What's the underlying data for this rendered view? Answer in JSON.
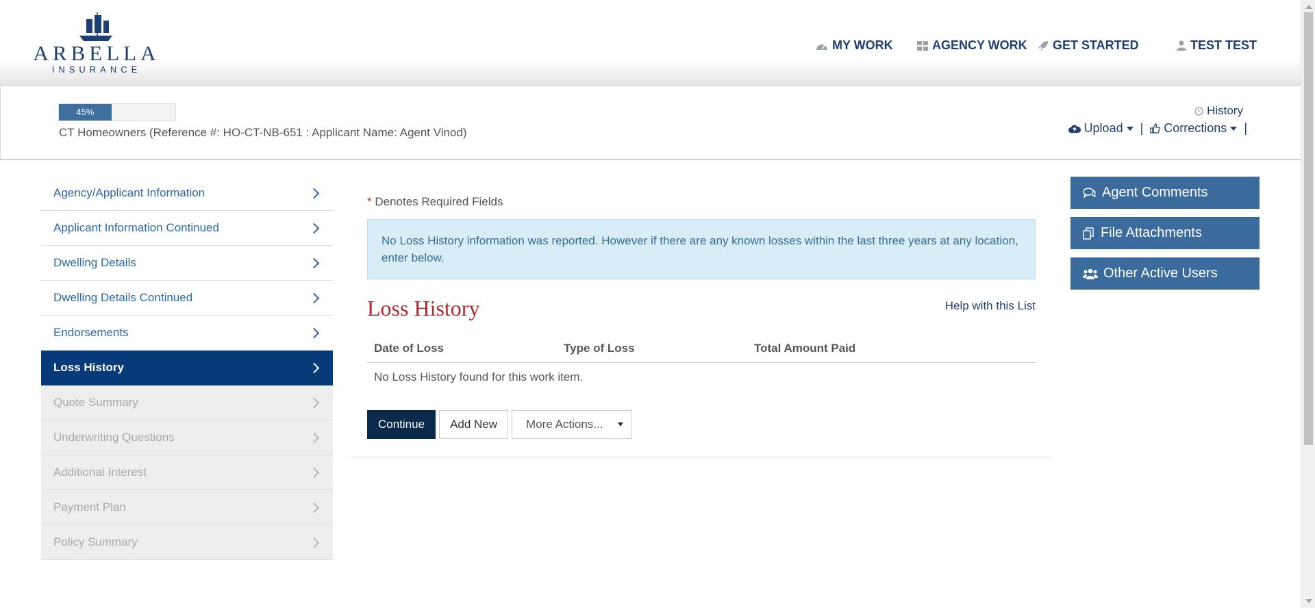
{
  "brand": {
    "name": "ARBELLA",
    "sub": "INSURANCE",
    "registered": "®"
  },
  "topnav": {
    "my_work": "MY WORK",
    "agency_work": "AGENCY WORK",
    "get_started": "GET STARTED",
    "user": "TEST TEST"
  },
  "progress": {
    "label": "45%",
    "value": 45
  },
  "reference": "CT Homeowners (Reference #: HO-CT-NB-651 : Applicant Name: Agent Vinod)",
  "subheader": {
    "history": "History",
    "upload": "Upload",
    "corrections": "Corrections",
    "sep": "|"
  },
  "sidebar": {
    "items": [
      {
        "label": "Agency/Applicant Information",
        "state": "enabled"
      },
      {
        "label": "Applicant Information Continued",
        "state": "enabled"
      },
      {
        "label": "Dwelling Details",
        "state": "enabled"
      },
      {
        "label": "Dwelling Details Continued",
        "state": "enabled"
      },
      {
        "label": "Endorsements",
        "state": "enabled"
      },
      {
        "label": "Loss History",
        "state": "active"
      },
      {
        "label": "Quote Summary",
        "state": "disabled"
      },
      {
        "label": "Underwriting Questions",
        "state": "disabled"
      },
      {
        "label": "Additional Interest",
        "state": "disabled"
      },
      {
        "label": "Payment Plan",
        "state": "disabled"
      },
      {
        "label": "Policy Summary",
        "state": "disabled"
      }
    ]
  },
  "main": {
    "required_star": "*",
    "required_text": "Denotes Required Fields",
    "info": "No Loss History information was reported. However if there are any known losses within the last three years at any location, enter below.",
    "title": "Loss History",
    "help": "Help with this List",
    "columns": [
      "Date of Loss",
      "Type of Loss",
      "Total Amount Paid"
    ],
    "empty": "No Loss History found for this work item.",
    "buttons": {
      "continue": "Continue",
      "add_new": "Add New",
      "more": "More Actions..."
    }
  },
  "right_panel": {
    "agent_comments": "Agent Comments",
    "file_attachments": "File Attachments",
    "other_users": "Other Active Users"
  },
  "colors": {
    "navy": "#1d3f73",
    "active": "#063a78",
    "accent_red": "#b22a30",
    "panel_btn": "#3b6b9c",
    "info_bg": "#d9edf7"
  }
}
